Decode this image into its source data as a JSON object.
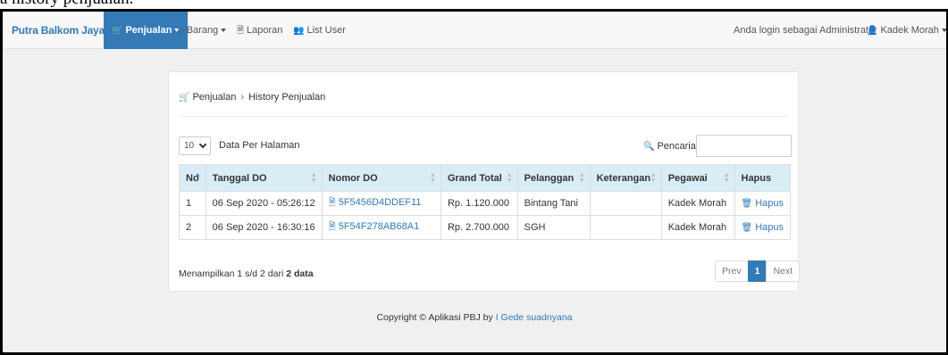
{
  "caption": "a history penjualan.",
  "navbar": {
    "brand": "Putra Balkom Jaya",
    "items": [
      {
        "label": "Penjualan",
        "icon": "cart-icon"
      },
      {
        "label": "Barang",
        "icon": "barcode-icon"
      },
      {
        "label": "Laporan",
        "icon": "file-icon"
      },
      {
        "label": "List User",
        "icon": "users-icon"
      }
    ],
    "login_text": "Anda login sebagai Administrator",
    "user_name": "Kadek Morah"
  },
  "breadcrumb": {
    "root": "Penjualan",
    "current": "History Penjualan"
  },
  "controls": {
    "page_length": "10",
    "page_length_label": "Data Per Halaman",
    "search_label": "Pencarian :",
    "search_value": ""
  },
  "table": {
    "columns": [
      "No",
      "Tanggal DO",
      "Nomor DO",
      "Grand Total",
      "Pelanggan",
      "Keterangan",
      "Pegawai",
      "Hapus"
    ],
    "rows": [
      {
        "no": "1",
        "tanggal": "06 Sep 2020 - 05:26:12",
        "nomor": "5F5456D4DDEF11",
        "total": "Rp. 1.120.000",
        "pelanggan": "Bintang Tani",
        "keterangan": "",
        "pegawai": "Kadek Morah",
        "hapus": "Hapus"
      },
      {
        "no": "2",
        "tanggal": "06 Sep 2020 - 16:30:16",
        "nomor": "5F54F278AB68A1",
        "total": "Rp. 2.700.000",
        "pelanggan": "SGH",
        "keterangan": "",
        "pegawai": "Kadek Morah",
        "hapus": "Hapus"
      }
    ]
  },
  "info": {
    "prefix": "Menampilkan 1 s/d 2 dari ",
    "total": "2 data"
  },
  "pagination": {
    "prev": "Prev",
    "current": "1",
    "next": "Next"
  },
  "footer": {
    "text": "Copyright © Aplikasi PBJ by ",
    "author": "I Gede suadnyana"
  },
  "colors": {
    "primary": "#337ab7",
    "header_bg": "#d9edf7"
  }
}
